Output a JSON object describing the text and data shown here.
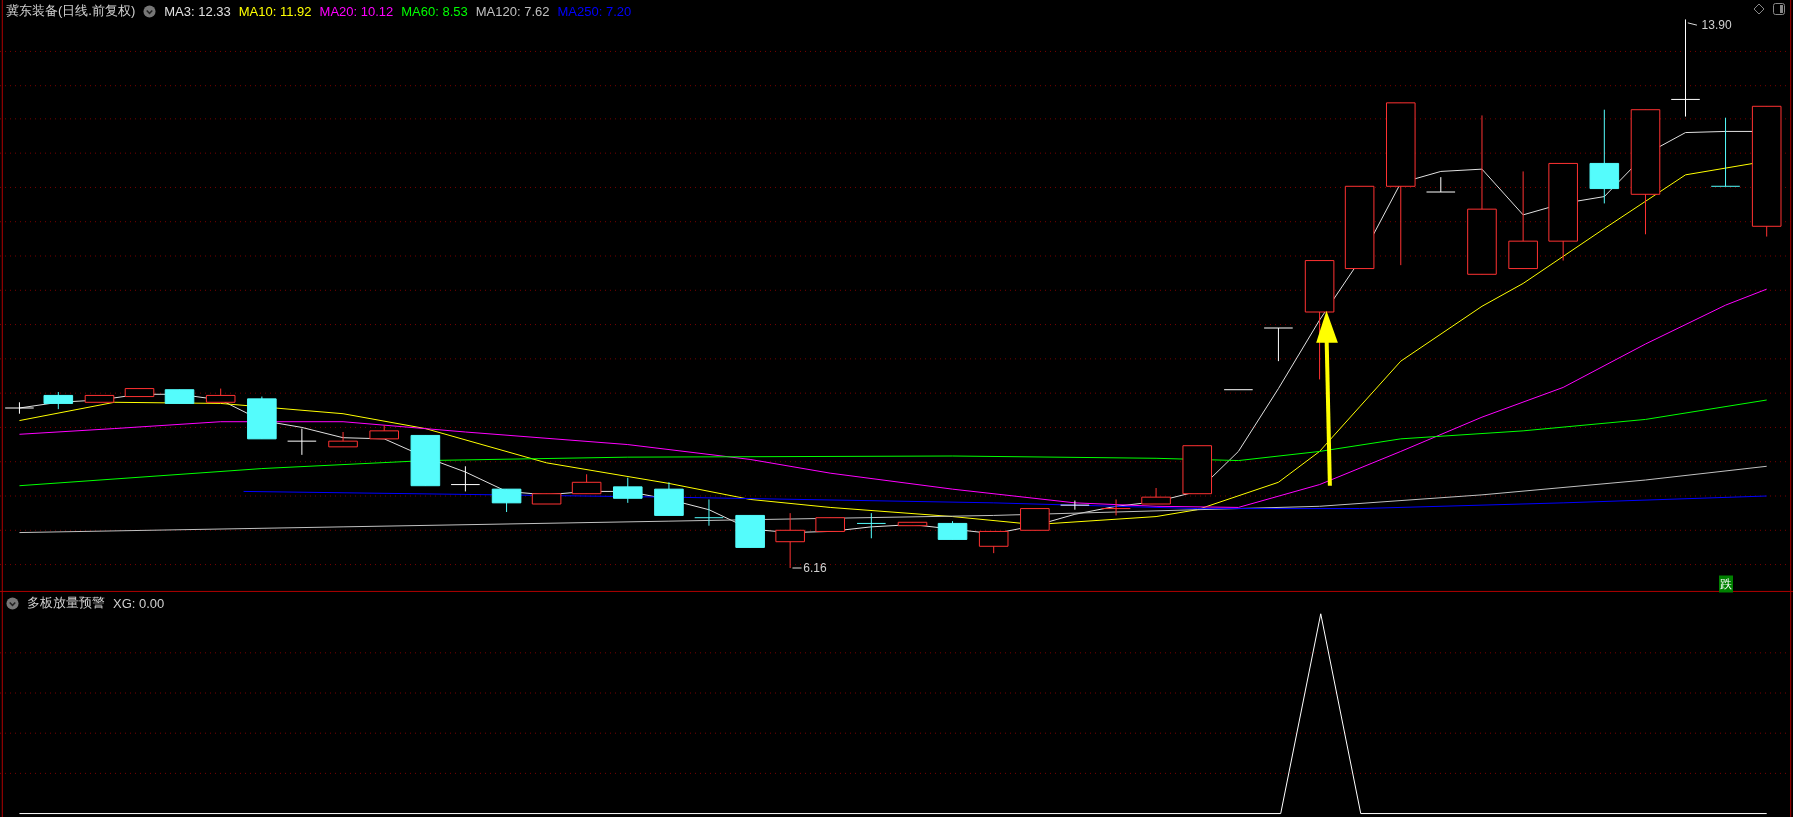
{
  "main_panel": {
    "title": "冀东装备(日线.前复权)",
    "indicators": [
      {
        "label": "MA3: 12.33",
        "color": "#e0e0e0"
      },
      {
        "label": "MA10: 11.92",
        "color": "#ffff00"
      },
      {
        "label": "MA20: 10.12",
        "color": "#ff00ff"
      },
      {
        "label": "MA60: 8.53",
        "color": "#00ff00"
      },
      {
        "label": "MA120: 7.62",
        "color": "#c0c0c0"
      },
      {
        "label": "MA250: 7.20",
        "color": "#0000ff"
      }
    ],
    "high_label": "13.90",
    "low_label": "6.16",
    "signal_badge": "跌"
  },
  "sub_panel": {
    "title": "多板放量预警",
    "reading": "XG: 0.00"
  }
}
